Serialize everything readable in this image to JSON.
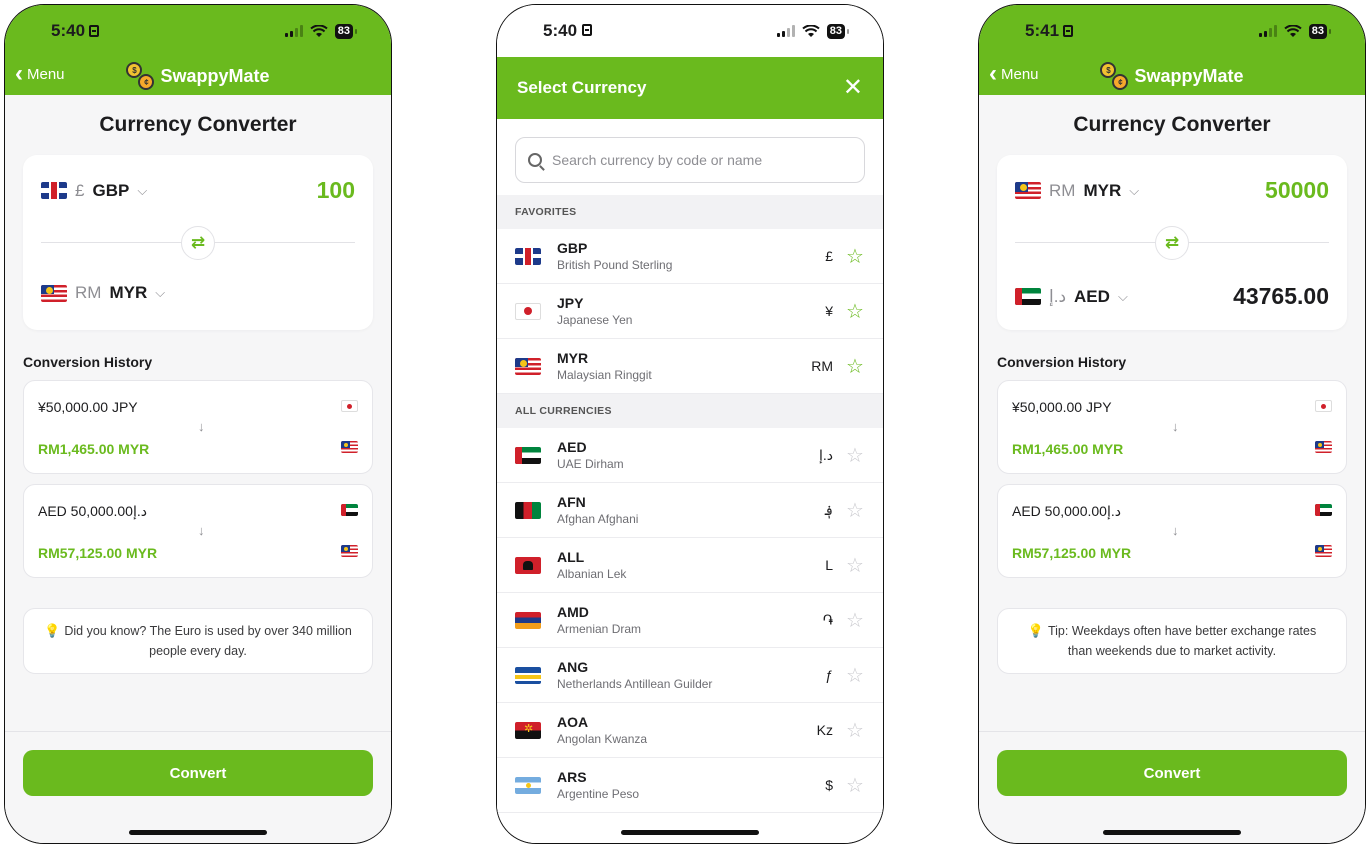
{
  "colors": {
    "accent": "#6aba1e",
    "text": "#1c1c1e",
    "muted": "#8e8e93"
  },
  "screen1": {
    "status": {
      "time": "5:40",
      "battery": "83"
    },
    "nav": {
      "back_label": "Menu",
      "app_name": "SwappyMate"
    },
    "title": "Currency Converter",
    "from": {
      "symbol": "£",
      "code": "GBP",
      "flag": "flag-gbp",
      "amount": "100"
    },
    "to": {
      "symbol": "RM",
      "code": "MYR",
      "flag": "flag-myr",
      "amount": ""
    },
    "history_title": "Conversion History",
    "history": [
      {
        "from": "¥50,000.00 JPY",
        "to": "RM1,465.00 MYR",
        "from_flag": "flag-jpy",
        "to_flag": "flag-myr"
      },
      {
        "from": "AED 50,000.00د.إ",
        "to": "RM57,125.00 MYR",
        "from_flag": "flag-aed",
        "to_flag": "flag-myr"
      }
    ],
    "arrow": "↓",
    "tip": "Did you know? The Euro is used by over 340 million people every day.",
    "convert_label": "Convert"
  },
  "screen2": {
    "status": {
      "time": "5:40",
      "battery": "83"
    },
    "header_title": "Select Currency",
    "close": "✕",
    "search_placeholder": "Search currency by code or name",
    "favorites_label": "FAVORITES",
    "all_label": "ALL CURRENCIES",
    "favorites": [
      {
        "code": "GBP",
        "name": "British Pound Sterling",
        "symbol": "£",
        "flag": "flag-gbp",
        "starred": true
      },
      {
        "code": "JPY",
        "name": "Japanese Yen",
        "symbol": "¥",
        "flag": "flag-jpy",
        "starred": true
      },
      {
        "code": "MYR",
        "name": "Malaysian Ringgit",
        "symbol": "RM",
        "flag": "flag-myr",
        "starred": true
      }
    ],
    "currencies": [
      {
        "code": "AED",
        "name": "UAE Dirham",
        "symbol": "د.إ",
        "flag": "flag-aed",
        "starred": false
      },
      {
        "code": "AFN",
        "name": "Afghan Afghani",
        "symbol": "؋",
        "flag": "flag-afn",
        "starred": false
      },
      {
        "code": "ALL",
        "name": "Albanian Lek",
        "symbol": "L",
        "flag": "flag-all",
        "starred": false
      },
      {
        "code": "AMD",
        "name": "Armenian Dram",
        "symbol": "֏",
        "flag": "flag-amd",
        "starred": false
      },
      {
        "code": "ANG",
        "name": "Netherlands Antillean Guilder",
        "symbol": "ƒ",
        "flag": "flag-ang",
        "starred": false
      },
      {
        "code": "AOA",
        "name": "Angolan Kwanza",
        "symbol": "Kz",
        "flag": "flag-aoa",
        "starred": false
      },
      {
        "code": "ARS",
        "name": "Argentine Peso",
        "symbol": "$",
        "flag": "flag-ars",
        "starred": false
      }
    ]
  },
  "screen3": {
    "status": {
      "time": "5:41",
      "battery": "83"
    },
    "nav": {
      "back_label": "Menu",
      "app_name": "SwappyMate"
    },
    "title": "Currency Converter",
    "from": {
      "symbol": "RM",
      "code": "MYR",
      "flag": "flag-myr",
      "amount": "50000"
    },
    "to": {
      "symbol": "د.إ",
      "code": "AED",
      "flag": "flag-aed",
      "amount": "43765.00"
    },
    "history_title": "Conversion History",
    "history": [
      {
        "from": "¥50,000.00 JPY",
        "to": "RM1,465.00 MYR",
        "from_flag": "flag-jpy",
        "to_flag": "flag-myr"
      },
      {
        "from": "AED 50,000.00د.إ",
        "to": "RM57,125.00 MYR",
        "from_flag": "flag-aed",
        "to_flag": "flag-myr"
      }
    ],
    "arrow": "↓",
    "tip": "Tip: Weekdays often have better exchange rates than weekends due to market activity.",
    "convert_label": "Convert"
  }
}
